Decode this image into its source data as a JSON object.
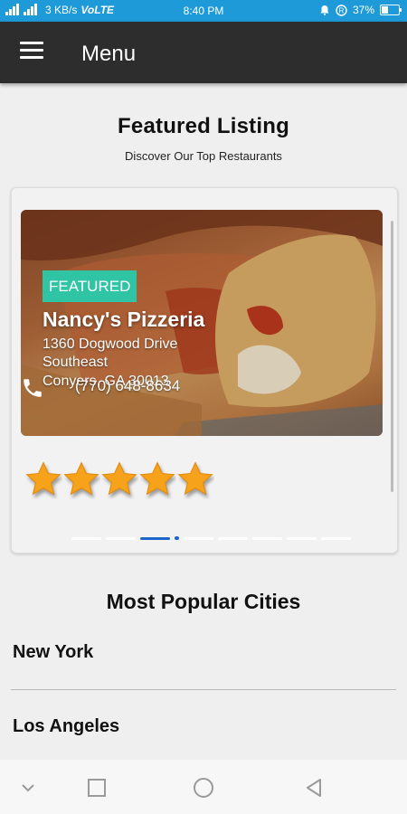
{
  "status_bar": {
    "speed": "3 KB/s",
    "network": "VoLTE",
    "time": "8:40 PM",
    "battery": "37%",
    "battery_level": 0.37,
    "icons": [
      "signal-icon",
      "alarm-icon",
      "data-saver-icon",
      "battery-icon"
    ]
  },
  "app_bar": {
    "title": "Menu",
    "menu_icon": "hamburger-icon"
  },
  "featured": {
    "title": "Featured Listing",
    "subtitle": "Discover Our Top Restaurants",
    "listing": {
      "badge": "FEATURED",
      "name": "Nancy's Pizzeria",
      "address_line1": "1360 Dogwood Drive",
      "address_line2": "Southeast",
      "address_line3": "Conyers, GA 30013",
      "phone": "(770) 648-8634",
      "rating": 5,
      "rating_max": 5
    },
    "carousel": {
      "page_count": 8,
      "active_index": 2
    },
    "colors": {
      "badge": "#2ec4a4",
      "active_dot": "#1b66c9",
      "star": "#f7a21b"
    }
  },
  "popular_cities": {
    "title": "Most Popular Cities",
    "cities": [
      "New York",
      "Los Angeles"
    ]
  },
  "nav_bar": {
    "buttons": [
      "collapse-icon",
      "recents-icon",
      "home-icon",
      "back-icon"
    ]
  }
}
